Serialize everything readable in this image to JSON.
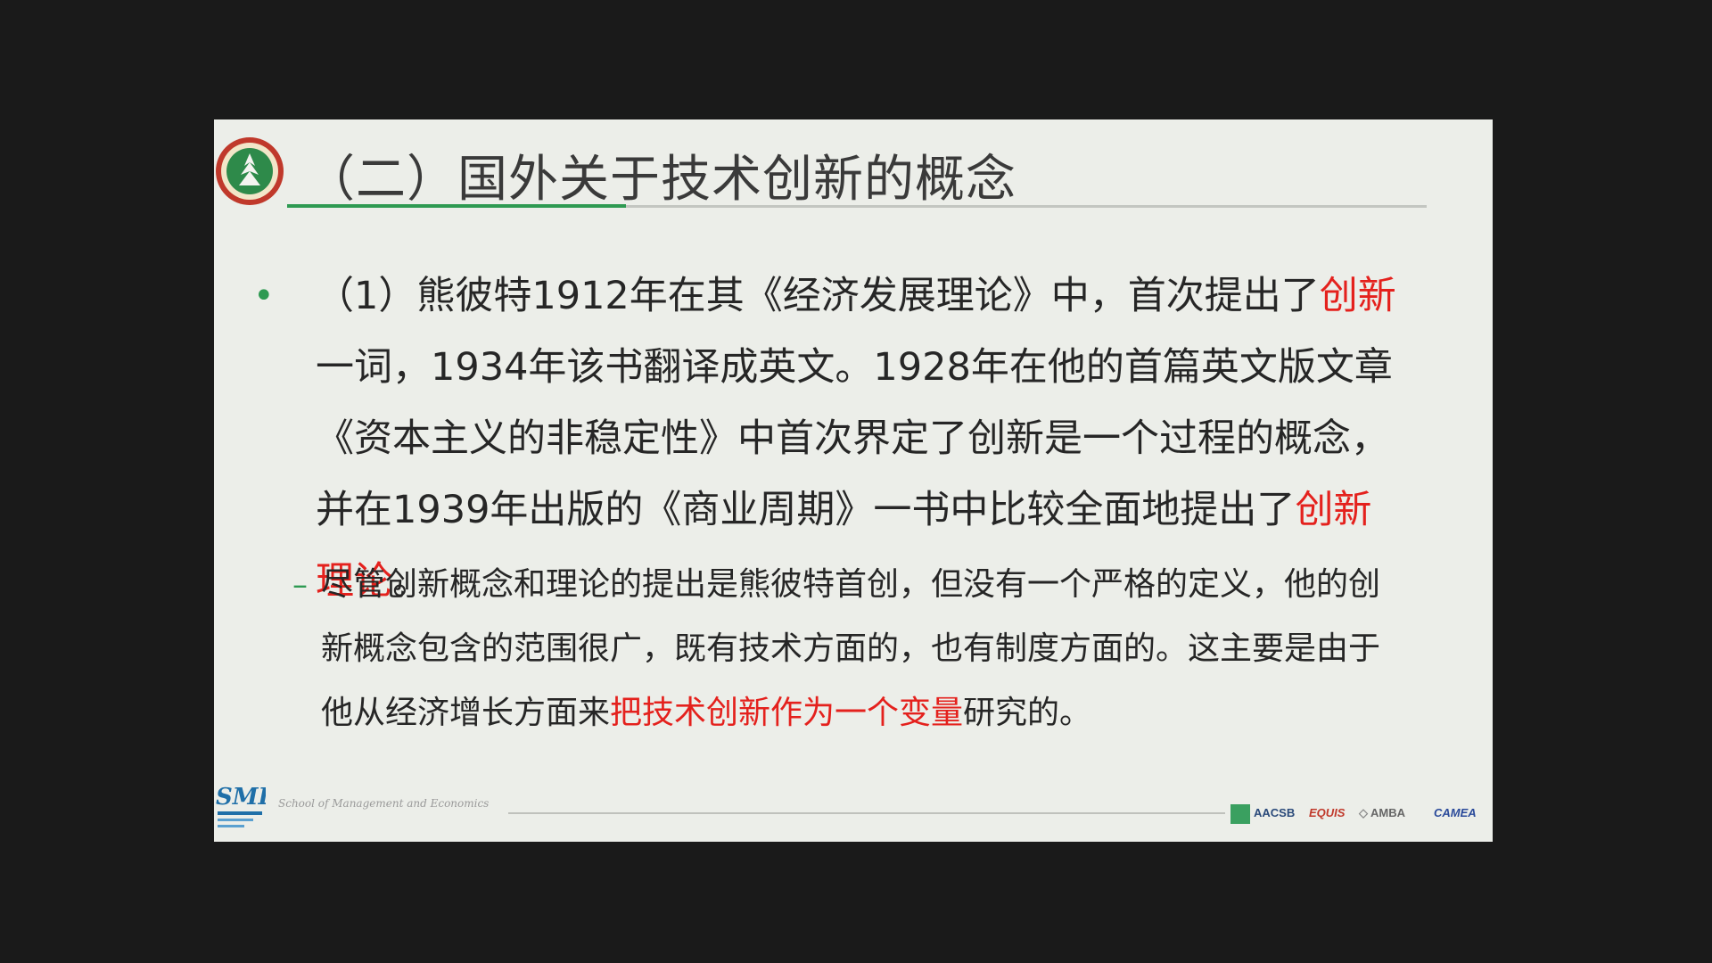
{
  "slide": {
    "title": "（二）国外关于技术创新的概念",
    "bullet": {
      "marker": "•",
      "text_a": "（1）熊彼特1912年在其《经济发展理论》中，首次提出了",
      "red_a": "创新",
      "text_b": "一词，1934年该书翻译成英文。1928年在他的首篇英文版文章《资本主义的非稳定性》中首次界定了创新是一个过程的概念，并在1939年出版的《商业周期》一书中比较全面地提出了",
      "red_b": "创新理论",
      "text_c": "。"
    },
    "sub": {
      "marker": "–",
      "text_a": "尽管创新概念和理论的提出是熊彼特首创，但没有一个严格的定义，他的创新概念包含的范围很广，既有技术方面的，也有制度方面的。这主要是由于他从经济增长方面来",
      "red_a": "把技术创新作为一个变量",
      "text_b": "研究的。"
    },
    "footer": {
      "logo_text": "SME",
      "school": "School of Management and Economics",
      "accreditations": [
        "AACSB",
        "EQUIS",
        "AMBA",
        "CAMEA"
      ]
    }
  },
  "colors": {
    "accent_green": "#2e9a52",
    "highlight_red": "#e4211d",
    "slide_bg": "#eceee9"
  }
}
